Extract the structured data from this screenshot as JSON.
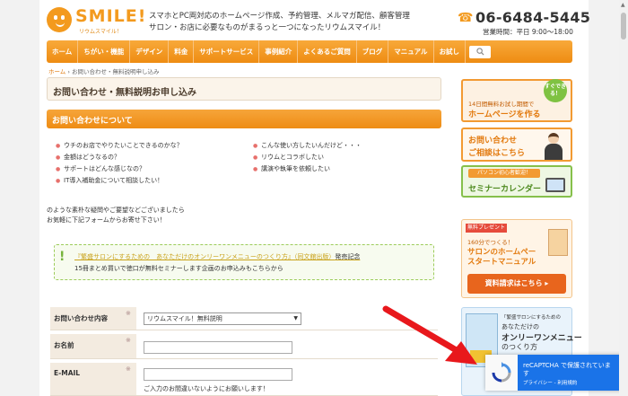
{
  "header": {
    "logo_text": "SMILE!",
    "logo_sub": "リウムスマイル！",
    "tagline_1": "スマホとPC両対応のホームページ作成、予約管理、メルマガ配信、顧客管理",
    "tagline_2": "サロン・お店に必要なものがまるっと一つになったリウムスマイル！",
    "phone": "06-6484-5445",
    "hours": "営業時間：平日 9:00〜18:00"
  },
  "nav": {
    "items": [
      "ホーム",
      "ちがい・機能",
      "デザイン",
      "料金",
      "サポートサービス",
      "事例紹介",
      "よくあるご質問",
      "ブログ",
      "マニュアル",
      "お試し"
    ]
  },
  "breadcrumb": {
    "home": "ホーム",
    "sep": " › ",
    "current": "お問い合わせ・無料説明申し込み"
  },
  "main": {
    "page_title": "お問い合わせ・無料説明お申し込み",
    "section_title": "お問い合わせについて",
    "questions_left": [
      "ウチのお店でやりたいことできるのかな？",
      "金額はどうなるの？",
      "サポートはどんな感じなの？",
      "IT導入補助金について相談したい！"
    ],
    "questions_right": [
      "こんな使い方したいんだけど・・・",
      "リウムとコラボしたい",
      "講演や執筆を依頼したい"
    ],
    "intro_1": "のような素朴な疑問やご要望などございましたら",
    "intro_2": "お気軽に下記フォームからお寄せ下さい！",
    "notice_link": "『繁盛サロンにするための　あなただけのオンリーワンメニューのつくり方』（同文舘出版）",
    "notice_date": "発売記念",
    "notice_line2": "15冊まとめ買いで徳口が無料セミナーします企画のお申込みもこちらから"
  },
  "form": {
    "inquiry_label": "お問い合わせ内容",
    "inquiry_selected": "リウムスマイル！無料説明",
    "name_label": "お名前",
    "email_label": "E-MAIL",
    "email_note": "ご入力のお間違いないようにお願いします！",
    "required_mark": "※"
  },
  "sidebar": {
    "banner1_badge": "すぐできる！",
    "banner1_small": "14日間無料お試し期間で",
    "banner1_big": "ホームページを作る",
    "banner2_l1": "お問い合わせ",
    "banner2_l2": "ご相談はこちら",
    "banner3_top": "パソコン初心者歓迎！",
    "banner3_main": "セミナーカレンダー",
    "banner4_tag": "無料プレゼント",
    "banner4_l1": "160分でつくる！",
    "banner4_l2": "サロンのホームペー",
    "banner4_l3": "スタートマニュアル",
    "banner4_btn": "資料請求はこちら ▸",
    "banner5_small": "「繁盛サロンにするための",
    "banner5_l1": "あなただけの",
    "banner5_l2": "オンリーワンメニュー",
    "banner5_l3": "のつくり方"
  },
  "recaptcha": {
    "title": "reCAPTCHA で保護されていま",
    "title2": "す",
    "links": "プライバシー - 利用規約"
  },
  "colors": {
    "brand_orange": "#ee8c12",
    "accent_red": "#e22",
    "recaptcha_blue": "#1a73e8"
  }
}
